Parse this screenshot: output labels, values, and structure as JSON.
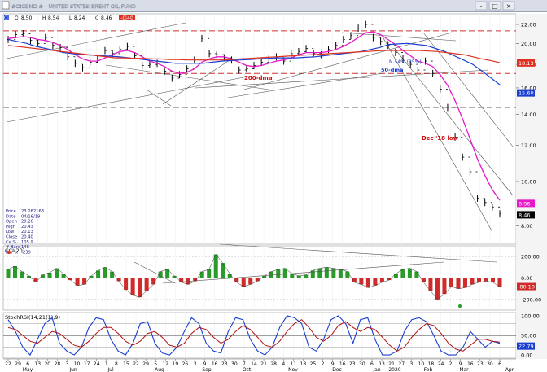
{
  "window": {
    "title": "#OICBNO # - UNITED STATES BRENT OIL FUND",
    "toolbar": {
      "o_label": "O",
      "o_value": "8.50",
      "h_label": "H",
      "h_value": "8.54",
      "l_label": "L",
      "l_value": "8.24",
      "c_label": "C",
      "c_value": "8.46",
      "chg_value": "-0.40"
    },
    "controls": [
      "-",
      "□",
      "×"
    ],
    "colors": {
      "background": "#ffffff",
      "titlebar": "#d8dde8",
      "accent": "#1a3fd0"
    }
  },
  "info_box": {
    "rows": [
      {
        "label": "Price",
        "value": "23.262163"
      },
      {
        "label": "Date",
        "value": "04/16/19"
      },
      {
        "label": "Open",
        "value": "20.26"
      },
      {
        "label": "High",
        "value": "20.43"
      },
      {
        "label": "Low",
        "value": "20.13"
      },
      {
        "label": "Close",
        "value": "20.40"
      },
      {
        "label": "Ce %",
        "value": "105.9"
      },
      {
        "label": "# Bars",
        "value": "148"
      },
      {
        "label": "Bar Ix",
        "value": "-239"
      }
    ]
  },
  "chart_data": [
    {
      "type": "line",
      "panel": "price",
      "ylim": [
        7.3,
        23.2
      ],
      "yscale": "log",
      "yticks": [
        "22.00",
        "20.00",
        "18.00",
        "16.00",
        "14.00",
        "12.00",
        "10.00",
        "8.00"
      ],
      "yticks_values": [
        22,
        20,
        18,
        16,
        14,
        12,
        10,
        8
      ],
      "series": [
        {
          "key": "close",
          "color": "#000000",
          "values": [
            20.4,
            20.9,
            21.0,
            20.3,
            20.0,
            20.6,
            19.8,
            19.6,
            18.7,
            18.1,
            17.7,
            18.2,
            18.5,
            19.3,
            19.0,
            19.4,
            19.7,
            18.8,
            17.9,
            18.0,
            18.1,
            17.4,
            16.8,
            17.1,
            17.6,
            18.4,
            20.5,
            19.0,
            18.9,
            18.6,
            18.4,
            17.5,
            17.6,
            17.9,
            18.2,
            18.5,
            18.7,
            18.3,
            19.0,
            19.2,
            19.5,
            19.0,
            18.9,
            19.4,
            19.8,
            20.4,
            20.8,
            21.6,
            22.0,
            20.6,
            20.2,
            19.8,
            19.1,
            18.5,
            18.0,
            17.5,
            18.3,
            17.2,
            15.9,
            14.5,
            12.5,
            11.3,
            10.5,
            9.2,
            9.0,
            8.8,
            8.5
          ]
        },
        {
          "key": "ma-pink",
          "color": "#e619c8",
          "values": [
            20.5,
            20.6,
            20.7,
            20.6,
            20.4,
            20.3,
            20.1,
            19.8,
            19.4,
            18.9,
            18.5,
            18.3,
            18.3,
            18.6,
            18.9,
            19.2,
            19.3,
            19.1,
            18.7,
            18.3,
            18.1,
            17.8,
            17.4,
            17.2,
            17.3,
            17.6,
            18.2,
            18.5,
            18.7,
            18.7,
            18.5,
            18.2,
            17.9,
            17.8,
            17.9,
            18.1,
            18.3,
            18.4,
            18.6,
            18.9,
            19.1,
            19.1,
            19.1,
            19.2,
            19.4,
            19.7,
            20.1,
            20.6,
            21.1,
            21.2,
            20.9,
            20.4,
            19.9,
            19.3,
            18.8,
            18.3,
            18.1,
            17.8,
            17.1,
            16.2,
            15.0,
            13.7,
            12.4,
            11.2,
            10.3,
            9.6,
            9.1
          ]
        },
        {
          "key": "ma-blue",
          "color": "#1a3fd0",
          "values": [
            20.4,
            20.2,
            20.0,
            19.7,
            19.5,
            19.3,
            19.1,
            19.0,
            18.9,
            18.85,
            18.8,
            18.75,
            18.7,
            18.6,
            18.5,
            18.4,
            18.3,
            18.2,
            18.1,
            18.1,
            18.1,
            18.1,
            18.2,
            18.3,
            18.35,
            18.4,
            18.45,
            18.5,
            18.55,
            18.6,
            18.6,
            18.6,
            18.65,
            18.7,
            18.8,
            18.9,
            19.0,
            19.1,
            19.2,
            19.4,
            19.6,
            19.9,
            19.95,
            20.0,
            19.9,
            19.8,
            19.5,
            19.2,
            18.8,
            18.4,
            18.0,
            17.4,
            16.8,
            16.2
          ]
        },
        {
          "key": "ma-red",
          "color": "#e03020",
          "values": [
            19.8,
            19.7,
            19.6,
            19.5,
            19.4,
            19.3,
            19.2,
            19.1,
            19.0,
            18.9,
            18.8,
            18.7,
            18.6,
            18.6,
            18.55,
            18.55,
            18.5,
            18.5,
            18.45,
            18.45,
            18.4,
            18.4,
            18.4,
            18.4,
            18.4,
            18.45,
            18.5,
            18.55,
            18.6,
            18.65,
            18.7,
            18.75,
            18.8,
            18.85,
            18.9,
            18.95,
            19.0,
            19.05,
            19.1,
            19.15,
            19.2,
            19.25,
            19.3,
            19.3,
            19.3,
            19.3,
            19.3,
            19.25,
            19.2,
            19.1,
            19.0,
            18.9,
            18.7,
            18.5,
            18.35,
            18.15
          ]
        }
      ],
      "annotations": [
        "200-dma",
        "50-dma",
        "N 54% (35%)",
        "Dec '18 low"
      ],
      "price_labels": [
        {
          "value": "18.13",
          "color": "#e03020"
        },
        {
          "value": "15.60",
          "color": "#1a3fd0"
        },
        {
          "value": "8.96",
          "color": "#e619c8"
        },
        {
          "value": "8.46",
          "color": "#000000"
        }
      ],
      "hlines": [
        {
          "y": 21.3,
          "style": "dashed",
          "color": "#d03030"
        },
        {
          "y": 17.2,
          "style": "dashed",
          "color": "#d03030"
        },
        {
          "y": 14.5,
          "style": "dashed",
          "color": "#666666"
        }
      ]
    },
    {
      "type": "bar",
      "panel": "cci",
      "title": "CCI(20)",
      "ylim": [
        -300,
        300
      ],
      "yticks": [
        "200.00",
        "0.00",
        "-200.00"
      ],
      "yticks_values": [
        200,
        0,
        -200
      ],
      "current_value": "-80.10",
      "values": [
        80,
        110,
        60,
        20,
        -40,
        30,
        50,
        90,
        40,
        -20,
        -70,
        -60,
        20,
        70,
        100,
        60,
        -30,
        -110,
        -160,
        -180,
        -120,
        -60,
        60,
        80,
        20,
        -40,
        -60,
        -30,
        60,
        80,
        220,
        140,
        40,
        -40,
        -80,
        -60,
        -30,
        20,
        60,
        80,
        90,
        40,
        20,
        30,
        70,
        90,
        100,
        90,
        80,
        60,
        -40,
        -60,
        -90,
        -70,
        -40,
        -20,
        40,
        80,
        90,
        60,
        -40,
        -120,
        -200,
        -150,
        -80,
        -100,
        -90,
        -60,
        -40,
        -30,
        -40,
        -80
      ]
    },
    {
      "type": "line",
      "panel": "stochrsi",
      "title": "StochRSI(14,21(1),9)",
      "ylim": [
        -8,
        108
      ],
      "yticks": [
        "100.00",
        "50.00",
        "0.00"
      ],
      "yticks_values": [
        100,
        50,
        0
      ],
      "current_value": "22.79",
      "series": [
        {
          "key": "stochrsi-k",
          "color": "#1a3fd0",
          "values": [
            90,
            60,
            20,
            0,
            40,
            80,
            95,
            30,
            10,
            0,
            20,
            70,
            95,
            90,
            40,
            10,
            0,
            30,
            80,
            85,
            30,
            5,
            0,
            20,
            60,
            95,
            80,
            30,
            10,
            5,
            60,
            95,
            90,
            40,
            10,
            0,
            20,
            70,
            100,
            95,
            80,
            20,
            10,
            40,
            90,
            100,
            80,
            30,
            90,
            95,
            40,
            0,
            0,
            10,
            60,
            90,
            95,
            85,
            50,
            10,
            0,
            0,
            20,
            60,
            40,
            20,
            35,
            30
          ]
        },
        {
          "key": "stochrsi-d",
          "color": "#b01010",
          "values": [
            70,
            65,
            50,
            35,
            30,
            45,
            60,
            55,
            40,
            25,
            20,
            35,
            55,
            70,
            70,
            55,
            35,
            25,
            35,
            55,
            60,
            45,
            25,
            20,
            30,
            55,
            70,
            65,
            45,
            30,
            40,
            60,
            75,
            65,
            45,
            25,
            20,
            35,
            60,
            80,
            90,
            70,
            45,
            35,
            50,
            75,
            85,
            70,
            60,
            70,
            65,
            45,
            25,
            10,
            20,
            45,
            65,
            80,
            75,
            55,
            30,
            15,
            10,
            25,
            40,
            40,
            35,
            33
          ]
        }
      ],
      "hlines": [
        80,
        50,
        20
      ]
    }
  ],
  "x_axis": {
    "day_labels": [
      "22",
      "29",
      "6",
      "13",
      "20",
      "28",
      "3",
      "10",
      "17",
      "24",
      "1",
      "8",
      "15",
      "22",
      "29",
      "5",
      "12",
      "19",
      "26",
      "3",
      "9",
      "16",
      "23",
      "30",
      "7",
      "14",
      "21",
      "28",
      "4",
      "11",
      "18",
      "25",
      "2",
      "9",
      "16",
      "23",
      "30",
      "6",
      "13",
      "21",
      "27",
      "3",
      "10",
      "18",
      "24",
      "2",
      "9",
      "16",
      "23",
      "30",
      "6"
    ],
    "month_labels": [
      "May",
      "Jun",
      "Jul",
      "Aug",
      "Sep",
      "Oct",
      "Nov",
      "Dec",
      "Jan",
      "2020",
      "Feb",
      "Mar",
      "Apr"
    ]
  }
}
